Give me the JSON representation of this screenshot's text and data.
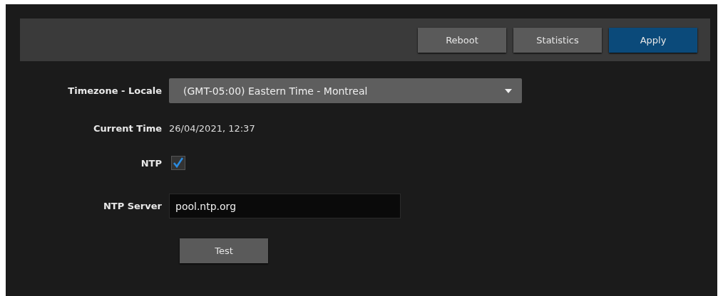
{
  "toolbar": {
    "buttons": [
      {
        "label": "Reboot",
        "kind": "secondary"
      },
      {
        "label": "Statistics",
        "kind": "secondary"
      },
      {
        "label": "Apply",
        "kind": "primary"
      }
    ]
  },
  "form": {
    "timezone": {
      "label": "Timezone - Locale",
      "value": "(GMT-05:00) Eastern Time - Montreal"
    },
    "current_time": {
      "label": "Current Time",
      "value": "26/04/2021, 12:37"
    },
    "ntp": {
      "label": "NTP",
      "checked": true
    },
    "ntp_server": {
      "label": "NTP Server",
      "value": "pool.ntp.org"
    },
    "test_button": {
      "label": "Test"
    }
  }
}
